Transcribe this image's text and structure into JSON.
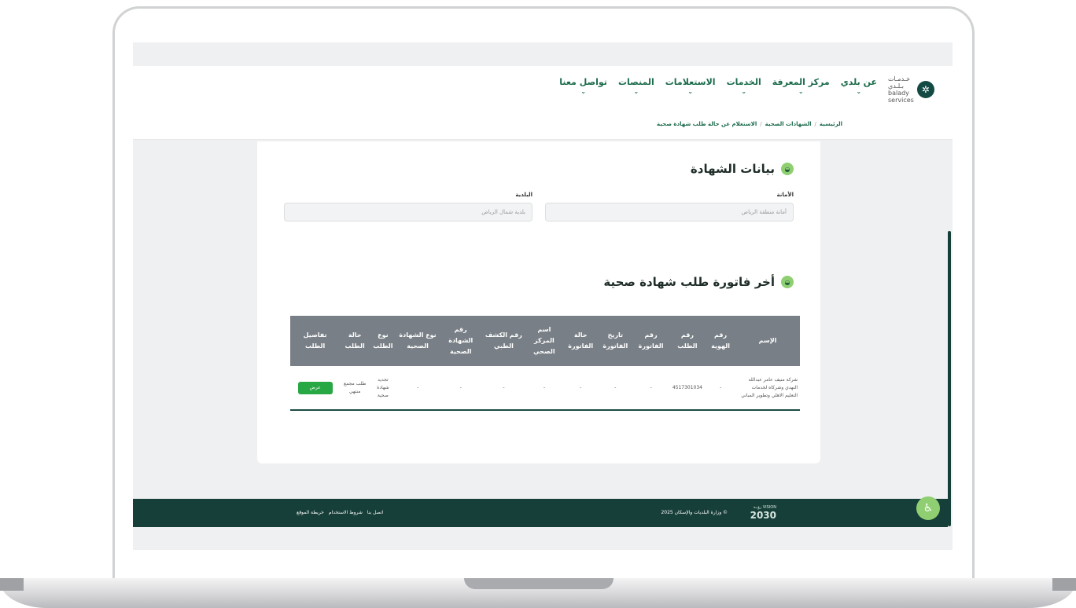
{
  "header": {
    "logo": {
      "icon": "palm-icon",
      "line1": "خـدمـات",
      "line2": "بـلـدي",
      "line3": "balady",
      "line4": "services"
    },
    "nav": [
      {
        "label": "عن بلدي"
      },
      {
        "label": "مركز المعرفة"
      },
      {
        "label": "الخدمات"
      },
      {
        "label": "الاستعلامات"
      },
      {
        "label": "المنصات"
      },
      {
        "label": "تواصل معنا"
      }
    ],
    "breadcrumb": [
      "الرئيسية",
      "الشهادات الصحية",
      "الاستعلام عن حالة طلب شهادة صحية"
    ],
    "breadcrumb_sep": "/"
  },
  "certificate": {
    "title": "بيانات الشهادة",
    "amana_label": "الأمانة",
    "amana_value": "أمانة منطقة الرياض",
    "baladiya_label": "البلدية",
    "baladiya_value": "بلدية شمال الرياض"
  },
  "invoice": {
    "title": "أخر فاتورة طلب شهادة صحية",
    "columns": [
      "الإسم",
      "رقم الهوية",
      "رقم الطلب",
      "رقم الفاتورة",
      "تاريخ الفاتورة",
      "حالة الفاتورة",
      "اسم المركز الصحي",
      "رقم الكشف الطبي",
      "رقم الشهادة الصحية",
      "نوع الشهادة الصحية",
      "نوع الطلب",
      "حالة الطلب",
      "تفاصيل الطلب"
    ],
    "rows": [
      {
        "name": "شركة منيف عامر عبدالله النهدي وشركاه لخدمات التعليم الاهلي وتطوير المباني",
        "id_number": "-",
        "request_number": "4517301034",
        "invoice_number": "-",
        "invoice_date": "-",
        "invoice_status": "-",
        "health_center": "-",
        "medical_exam": "-",
        "health_cert_number": "-",
        "health_cert_type": "-",
        "request_type": "تجديد شهادة صحية",
        "request_status": "طلب مجمع منتهي",
        "details_button": "عرض"
      }
    ]
  },
  "footer": {
    "vision": "2030",
    "vision_small": "VISION رؤيـة",
    "copyright": "© وزارة البلديات والإسكان 2025",
    "links": [
      "اتصل بنا",
      "شروط الاستخدام",
      "خريطة الموقع"
    ]
  },
  "accessibility": {
    "icon": "accessibility-icon"
  }
}
